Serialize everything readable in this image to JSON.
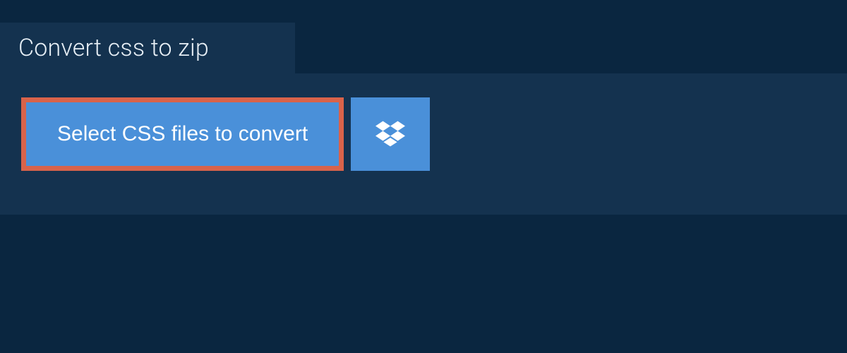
{
  "header": {
    "title": "Convert css to zip"
  },
  "actions": {
    "select_files_label": "Select CSS files to convert",
    "dropbox_icon": "dropbox-icon"
  },
  "colors": {
    "page_bg": "#0a2640",
    "panel_bg": "#14324f",
    "button_bg": "#4a90d9",
    "highlight_border": "#d9634a",
    "text_light": "#e6eef5",
    "text_white": "#ffffff"
  }
}
